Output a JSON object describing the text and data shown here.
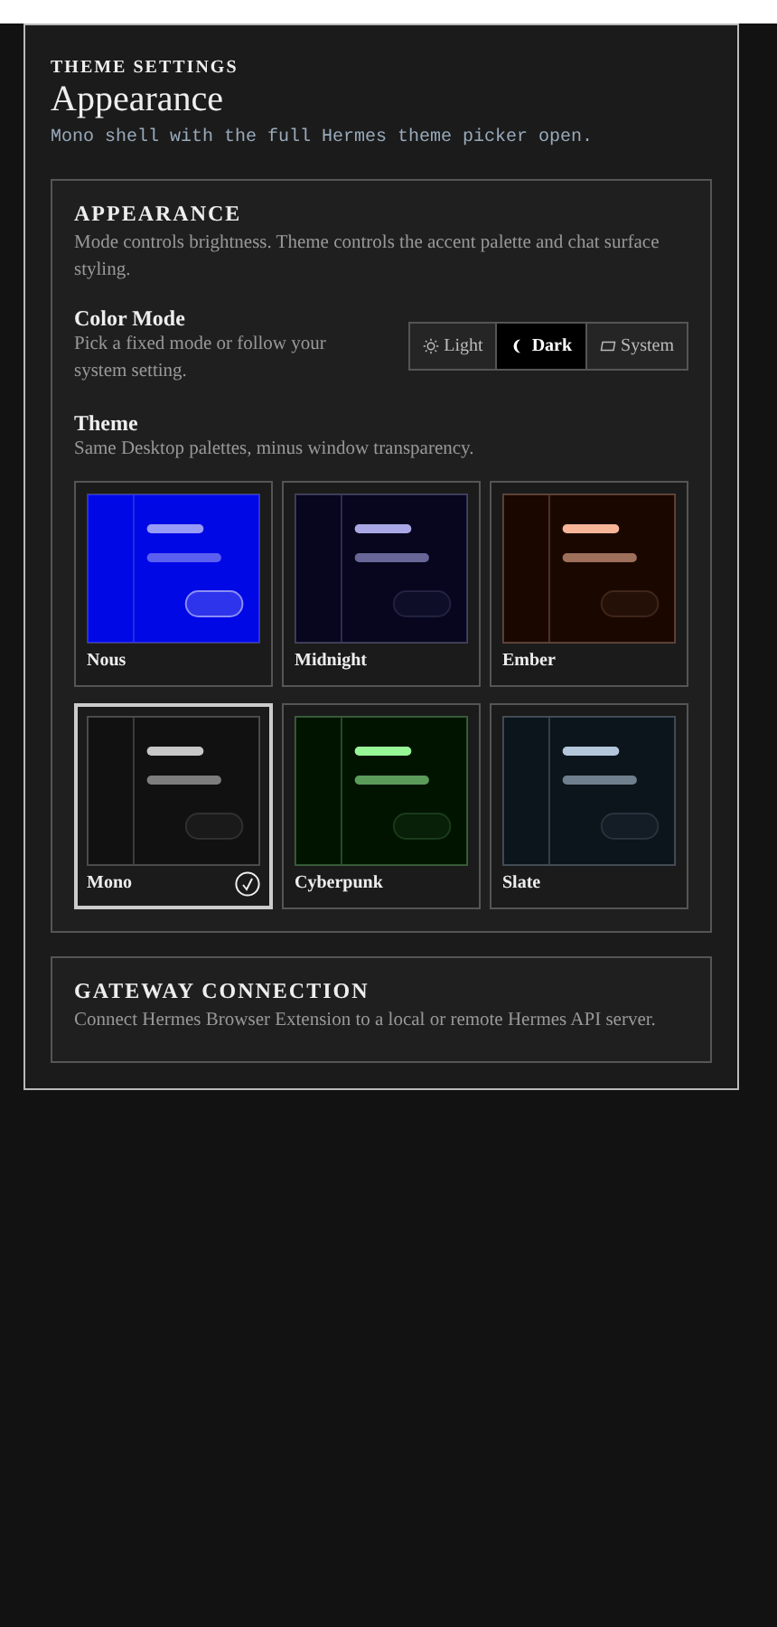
{
  "header": {
    "eyebrow": "THEME SETTINGS",
    "title": "Appearance",
    "subtitle": "Mono shell with the full Hermes theme picker open."
  },
  "appearance": {
    "title": "APPEARANCE",
    "description": "Mode controls brightness. Theme controls the accent palette and chat surface styling.",
    "color_mode": {
      "label": "Color Mode",
      "hint": "Pick a fixed mode or follow your system setting.",
      "options": [
        {
          "kind": "light",
          "label": "Light",
          "selected": false
        },
        {
          "kind": "dark",
          "label": "Dark",
          "selected": true
        },
        {
          "kind": "system",
          "label": "System",
          "selected": false
        }
      ]
    },
    "theme": {
      "label": "Theme",
      "hint": "Same Desktop palettes, minus window transparency.",
      "options": [
        {
          "name": "Nous",
          "color": "#0008e6",
          "selected": false
        },
        {
          "name": "Midnight",
          "color": "#07061e",
          "selected": false
        },
        {
          "name": "Ember",
          "color": "#1a0800",
          "selected": false
        },
        {
          "name": "Mono",
          "color": "#111111",
          "selected": true
        },
        {
          "name": "Cyberpunk",
          "color": "#001400",
          "selected": false
        },
        {
          "name": "Slate",
          "color": "#0c141c",
          "selected": false
        }
      ]
    }
  },
  "gateway": {
    "title": "GATEWAY CONNECTION",
    "description": "Connect Hermes Browser Extension to a local or remote Hermes API server."
  }
}
